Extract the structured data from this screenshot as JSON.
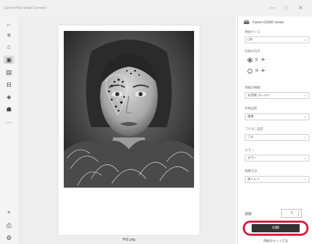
{
  "app": {
    "title": "Canon Print Smart Connect"
  },
  "window_controls": {
    "minimize": "—",
    "maximize": "□",
    "close": "✕"
  },
  "sidebar": {
    "items": [
      {
        "icon": "back-arrow-icon",
        "glyph": "←"
      },
      {
        "icon": "menu-icon",
        "glyph": "≡"
      },
      {
        "icon": "home-icon",
        "glyph": "⌂"
      },
      {
        "icon": "photo-print-icon",
        "glyph": "▣"
      },
      {
        "icon": "document-icon",
        "glyph": "▤"
      },
      {
        "icon": "scan-icon",
        "glyph": "⊟"
      },
      {
        "icon": "layout-icon",
        "glyph": "◈"
      },
      {
        "icon": "people-icon",
        "glyph": "☗"
      },
      {
        "icon": "more-icon",
        "glyph": "···"
      }
    ],
    "bottom": [
      {
        "icon": "add-icon",
        "glyph": "+"
      },
      {
        "icon": "printer-icon",
        "glyph": "⎙"
      },
      {
        "icon": "settings-icon",
        "glyph": "⚙"
      }
    ]
  },
  "preview": {
    "file_name": "P02.png"
  },
  "panel": {
    "printer_name": "Canon G6000 series",
    "fields": [
      {
        "label": "用紙サイズ",
        "value": "L判"
      },
      {
        "label": "用紙の種類",
        "value": "光沢紙 ゴールド"
      },
      {
        "label": "印刷品質",
        "value": "標準"
      },
      {
        "label": "フチなし設定",
        "value": "フチ"
      },
      {
        "label": "カラー",
        "value": "カラー"
      },
      {
        "label": "給紙方法",
        "value": "後トレイ"
      }
    ],
    "orientation_label": "印刷の向き",
    "orientation": [
      {
        "value": "縦",
        "selected": true
      },
      {
        "value": "横",
        "selected": false
      }
    ],
    "copies_label": "部数",
    "copies": "1",
    "print_button": "印刷",
    "settings_link": "用紙のセット方法",
    "highlight_color": "#d21f3c"
  }
}
